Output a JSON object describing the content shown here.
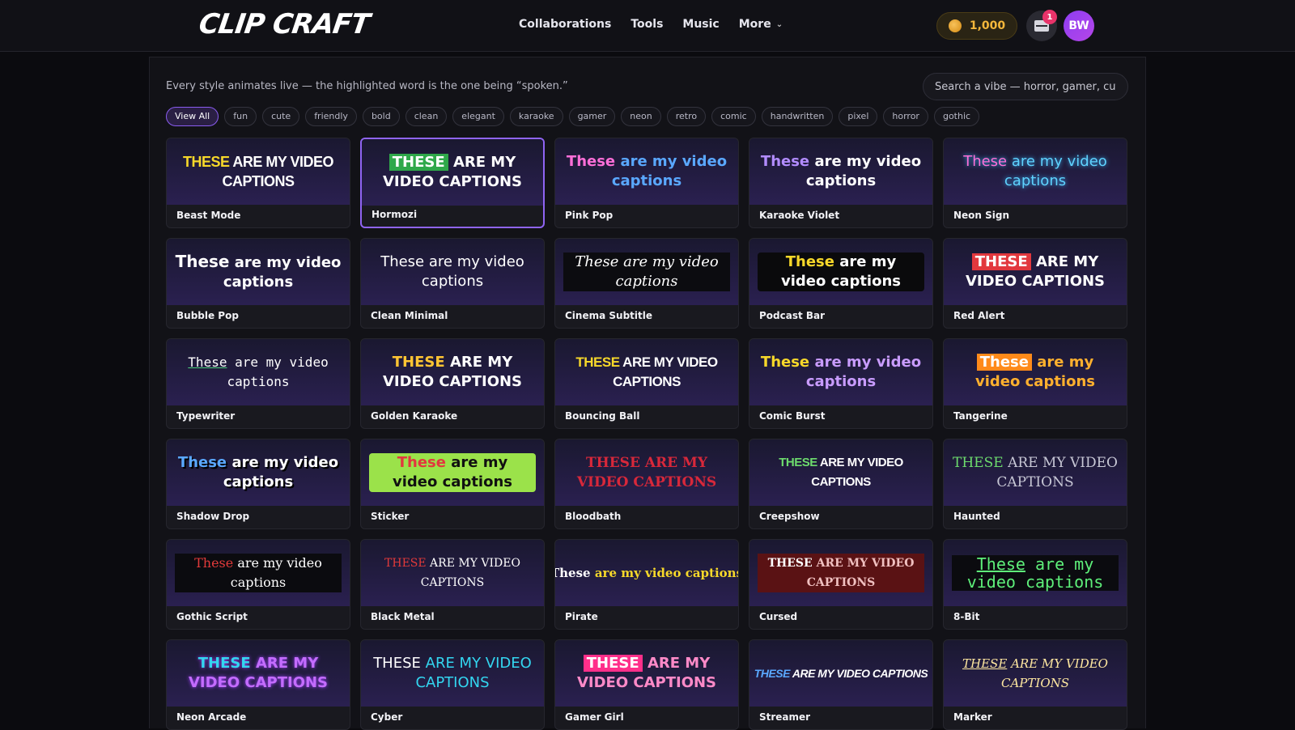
{
  "header": {
    "logo": "CLIP CRAFT",
    "nav": [
      "Collaborations",
      "Tools",
      "Music",
      "More"
    ],
    "coins": "1,000",
    "notification_count": "1",
    "avatar_initials": "BW"
  },
  "toolbar": {
    "hint": "Every style animates live — the highlighted word is the one being “spoken.”",
    "search_placeholder": "Search a vibe — horror, gamer, cute..."
  },
  "filters": [
    "View All",
    "fun",
    "cute",
    "friendly",
    "bold",
    "clean",
    "elegant",
    "karaoke",
    "gamer",
    "neon",
    "retro",
    "comic",
    "handwritten",
    "pixel",
    "horror",
    "gothic"
  ],
  "active_filter": "View All",
  "caption_text": {
    "first": "These",
    "rest": "are my video captions"
  },
  "styles": [
    {
      "name": "Beast Mode"
    },
    {
      "name": "Hormozi"
    },
    {
      "name": "Pink Pop"
    },
    {
      "name": "Karaoke Violet"
    },
    {
      "name": "Neon Sign"
    },
    {
      "name": "Bubble Pop"
    },
    {
      "name": "Clean Minimal"
    },
    {
      "name": "Cinema Subtitle"
    },
    {
      "name": "Podcast Bar"
    },
    {
      "name": "Red Alert"
    },
    {
      "name": "Typewriter"
    },
    {
      "name": "Golden Karaoke"
    },
    {
      "name": "Bouncing Ball"
    },
    {
      "name": "Comic Burst"
    },
    {
      "name": "Tangerine"
    },
    {
      "name": "Shadow Drop"
    },
    {
      "name": "Sticker"
    },
    {
      "name": "Bloodbath"
    },
    {
      "name": "Creepshow"
    },
    {
      "name": "Haunted"
    },
    {
      "name": "Gothic Script"
    },
    {
      "name": "Black Metal"
    },
    {
      "name": "Pirate"
    },
    {
      "name": "Cursed"
    },
    {
      "name": "8-Bit"
    },
    {
      "name": "Neon Arcade"
    },
    {
      "name": "Cyber"
    },
    {
      "name": "Gamer Girl"
    },
    {
      "name": "Streamer"
    },
    {
      "name": "Marker"
    }
  ],
  "selected_style": "Hormozi",
  "colors": {
    "accent": "#8f64f2",
    "coin": "#f5b73b",
    "badge": "#e8336a"
  }
}
